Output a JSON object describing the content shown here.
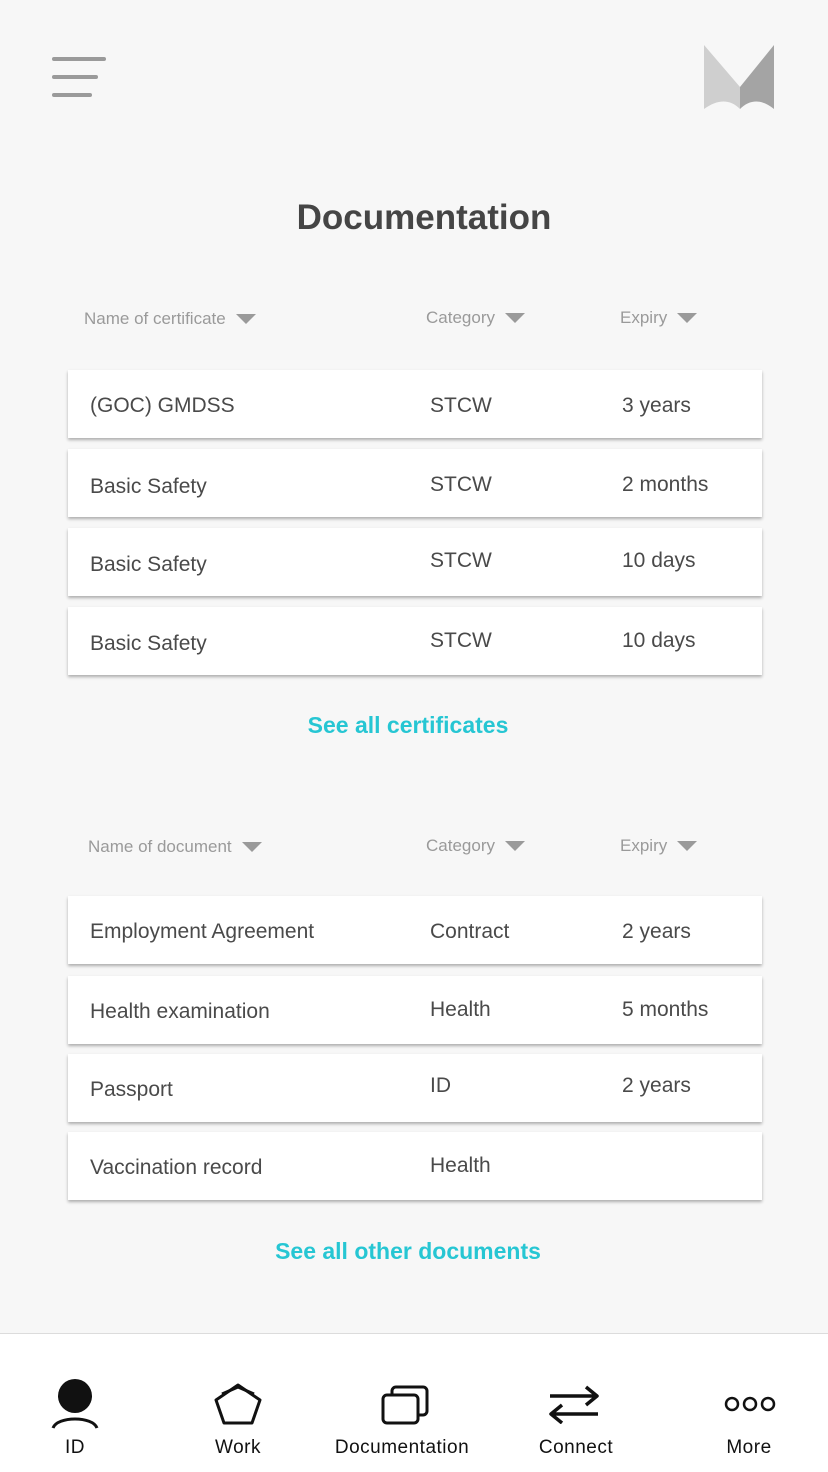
{
  "header": {
    "menu_icon": "hamburger-menu-icon",
    "logo_icon": "brand-m-logo-icon",
    "title": "Documentation"
  },
  "certificates": {
    "columns": {
      "name": "Name of certificate",
      "category": "Category",
      "expiry": "Expiry"
    },
    "rows": [
      {
        "name": "(GOC) GMDSS",
        "category": "STCW",
        "expiry": "3 years"
      },
      {
        "name": "Basic Safety",
        "category": "STCW",
        "expiry": "2 months"
      },
      {
        "name": "Basic Safety",
        "category": "STCW",
        "expiry": "10 days"
      },
      {
        "name": "Basic Safety",
        "category": "STCW",
        "expiry": "10 days"
      }
    ],
    "see_all": "See all certificates"
  },
  "documents": {
    "columns": {
      "name": "Name of document",
      "category": "Category",
      "expiry": "Expiry"
    },
    "rows": [
      {
        "name": "Employment Agreement",
        "category": "Contract",
        "expiry": "2 years"
      },
      {
        "name": "Health examination",
        "category": "Health",
        "expiry": "5 months"
      },
      {
        "name": "Passport",
        "category": "ID",
        "expiry": "2 years"
      },
      {
        "name": "Vaccination record",
        "category": "Health",
        "expiry": ""
      }
    ],
    "see_all": "See all other documents"
  },
  "tabbar": {
    "items": [
      {
        "label": "ID",
        "icon": "person-icon"
      },
      {
        "label": "Work",
        "icon": "pentagon-icon"
      },
      {
        "label": "Documentation",
        "icon": "stacked-documents-icon"
      },
      {
        "label": "Connect",
        "icon": "swap-arrows-icon"
      },
      {
        "label": "More",
        "icon": "three-dots-icon"
      }
    ]
  },
  "colors": {
    "accent": "#26c6d3",
    "background": "#f7f7f7",
    "title": "#454545",
    "muted": "#9a9a9a"
  }
}
